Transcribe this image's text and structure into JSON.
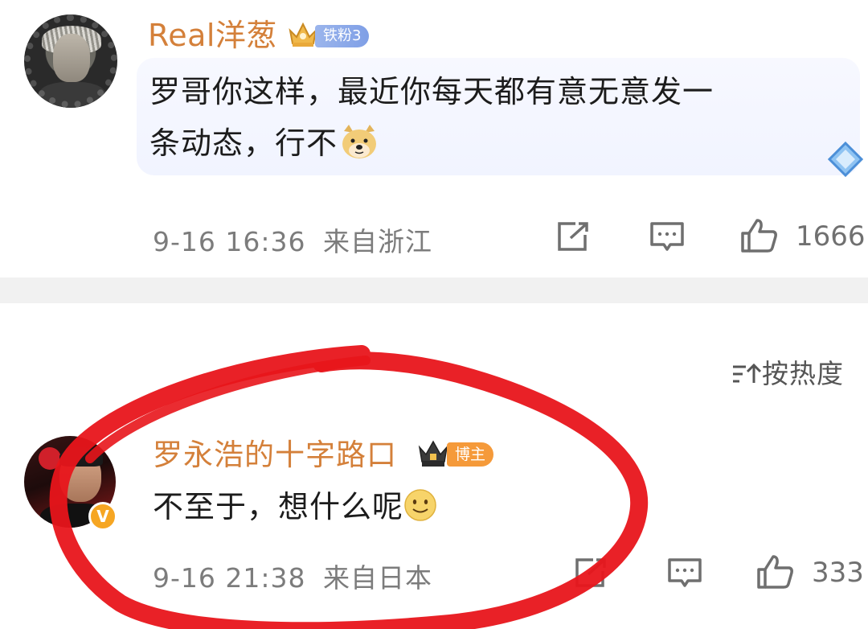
{
  "comments": [
    {
      "username": "Real洋葱",
      "badge": "铁粉3",
      "text_line1": "罗哥你这样，最近你每天都有意无意发一",
      "text_line2": "条动态，行不",
      "emoji": "doge",
      "timestamp": "9-16 16:36",
      "location": "来自浙江",
      "likes": "1666"
    },
    {
      "username": "罗永浩的十字路口",
      "badge": "博主",
      "verified_icon": "V",
      "text": "不至于，想什么呢",
      "emoji": "smile",
      "timestamp": "9-16 21:38",
      "location": "来自日本",
      "likes": "333"
    }
  ],
  "sort": {
    "label": "按热度"
  },
  "colors": {
    "username": "#d4803a",
    "annotation_circle": "#e8151b",
    "fan_badge": "#8ba8ea",
    "host_badge": "#f59a3a"
  },
  "icons": [
    "share-icon",
    "comment-icon",
    "like-icon",
    "crown-icon",
    "sort-icon",
    "diamond-icon"
  ]
}
